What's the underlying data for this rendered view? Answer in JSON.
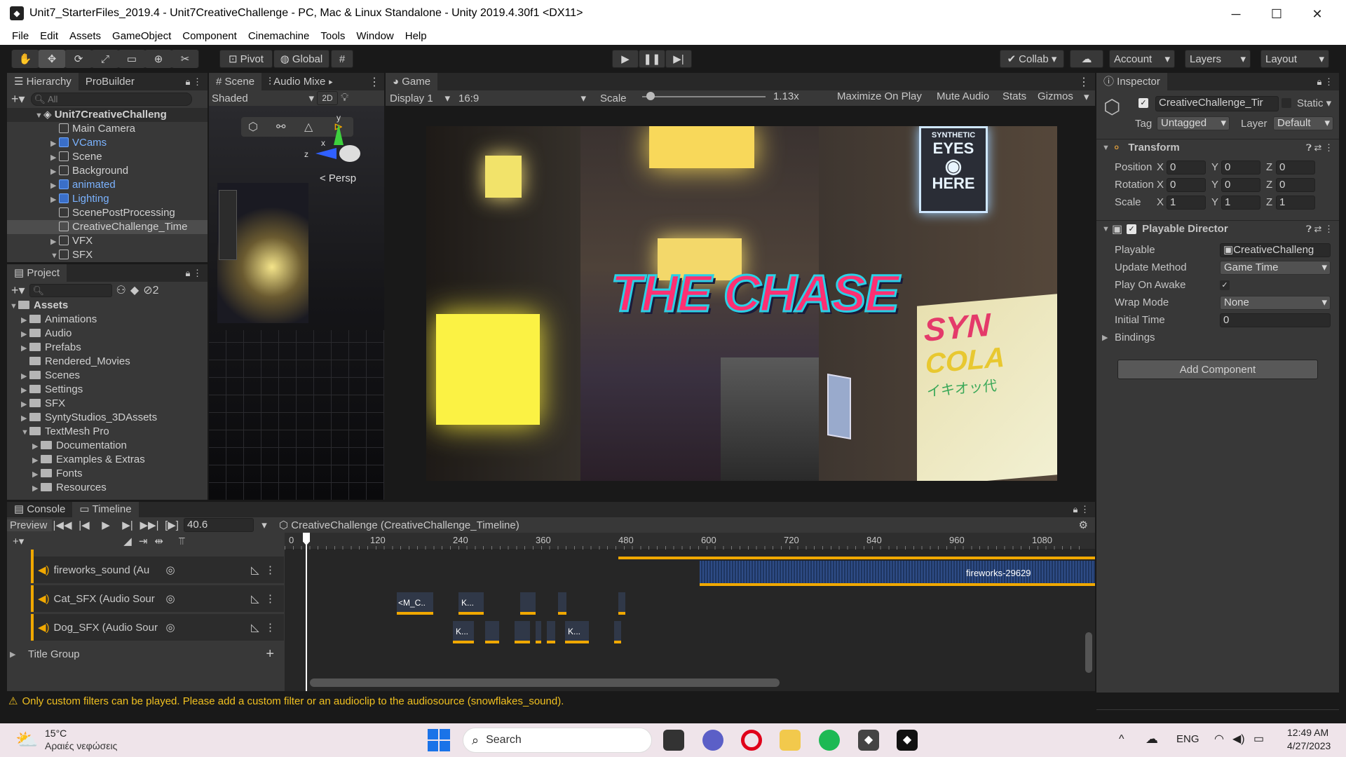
{
  "window": {
    "title": "Unit7_StarterFiles_2019.4 - Unit7CreativeChallenge - PC, Mac & Linux Standalone - Unity 2019.4.30f1 <DX11>",
    "minimize": "─",
    "maximize": "☐",
    "close": "✕"
  },
  "menu": [
    "File",
    "Edit",
    "Assets",
    "GameObject",
    "Component",
    "Cinemachine",
    "Tools",
    "Window",
    "Help"
  ],
  "toolbar": {
    "pivot": "Pivot",
    "global": "Global",
    "collab": "Collab",
    "account": "Account",
    "layers": "Layers",
    "layout": "Layout"
  },
  "hierarchy": {
    "tab": "Hierarchy",
    "tab2": "ProBuilder",
    "search_placeholder": "All",
    "scene": "Unit7CreativeChalleng",
    "items": [
      {
        "label": "Main Camera",
        "prefab": false
      },
      {
        "label": "VCams",
        "prefab": true
      },
      {
        "label": "Scene",
        "prefab": false
      },
      {
        "label": "Background",
        "prefab": false
      },
      {
        "label": "animated",
        "prefab": true
      },
      {
        "label": "Lighting",
        "prefab": true
      },
      {
        "label": "ScenePostProcessing",
        "prefab": false
      },
      {
        "label": "CreativeChallenge_Time",
        "prefab": false
      },
      {
        "label": "VFX",
        "prefab": false
      },
      {
        "label": "SFX",
        "prefab": false
      }
    ]
  },
  "project": {
    "tab": "Project",
    "hidden_count": "2",
    "root": "Assets",
    "folders": [
      "Animations",
      "Audio",
      "Prefabs",
      "Rendered_Movies",
      "Scenes",
      "Settings",
      "SFX",
      "SyntyStudios_3DAssets",
      "TextMesh Pro"
    ],
    "subfolders": [
      "Documentation",
      "Examples & Extras",
      "Fonts",
      "Resources"
    ]
  },
  "scene": {
    "tab": "Scene",
    "tab2": "Audio Mixe",
    "shading": "Shaded",
    "mode2d": "2D",
    "persp": "< Persp",
    "axis_x": "x",
    "axis_y": "y",
    "axis_z": "z"
  },
  "game": {
    "tab": "Game",
    "display": "Display 1",
    "aspect": "16:9",
    "scale_label": "Scale",
    "scale_value": "1.13x",
    "maximize": "Maximize On Play",
    "mute": "Mute Audio",
    "stats": "Stats",
    "gizmos": "Gizmos",
    "view": {
      "title": "THE CHASE",
      "sign1_line1": "SYNTHETIC",
      "sign1_line2": "EYES",
      "sign1_line3": "HERE",
      "sign2_line1": "SYN",
      "sign2_line2": "COLA",
      "sign2_line3": "イキオッ代"
    }
  },
  "inspector": {
    "tab": "Inspector",
    "object_name": "CreativeChallenge_Tir",
    "static": "Static",
    "tag_label": "Tag",
    "tag": "Untagged",
    "layer_label": "Layer",
    "layer": "Default",
    "transform": {
      "title": "Transform",
      "rows": [
        {
          "label": "Position",
          "x": "0",
          "y": "0",
          "z": "0"
        },
        {
          "label": "Rotation",
          "x": "0",
          "y": "0",
          "z": "0"
        },
        {
          "label": "Scale",
          "x": "1",
          "y": "1",
          "z": "1"
        }
      ]
    },
    "director": {
      "title": "Playable Director",
      "playable_label": "Playable",
      "playable": "CreativeChalleng",
      "update_label": "Update Method",
      "update": "Game Time",
      "awake_label": "Play On Awake",
      "wrap_label": "Wrap Mode",
      "wrap": "None",
      "initial_label": "Initial Time",
      "initial": "0",
      "bindings": "Bindings"
    },
    "add_component": "Add Component"
  },
  "timeline": {
    "tab_console": "Console",
    "tab": "Timeline",
    "preview": "Preview",
    "time": "40.6",
    "asset": "CreativeChallenge (CreativeChallenge_Timeline)",
    "ruler": [
      "0",
      "120",
      "240",
      "360",
      "480",
      "600",
      "720",
      "840",
      "960",
      "1080"
    ],
    "tracks": [
      {
        "label": "fireworks_sound (Au"
      },
      {
        "label": "Cat_SFX (Audio Sour"
      },
      {
        "label": "Dog_SFX (Audio Sour"
      }
    ],
    "group": "Title Group",
    "clip_fireworks": "fireworks-29629",
    "clip_cat1": "<M_C..",
    "clip_cat2": "K...",
    "clip_dog1": "K...",
    "clip_dog2": "K..."
  },
  "status": {
    "warning": "Only custom filters can be played. Please add a custom filter or an audioclip to the audiosource (snowflakes_sound)."
  },
  "taskbar": {
    "temp": "15°C",
    "weather": "Αραιές νεφώσεις",
    "search": "Search",
    "lang": "ENG",
    "time": "12:49 AM",
    "date": "4/27/2023"
  },
  "colors": {
    "accent_orange": "#f0a800",
    "selection_blue": "#3a72b0",
    "warning": "#f0c020"
  }
}
